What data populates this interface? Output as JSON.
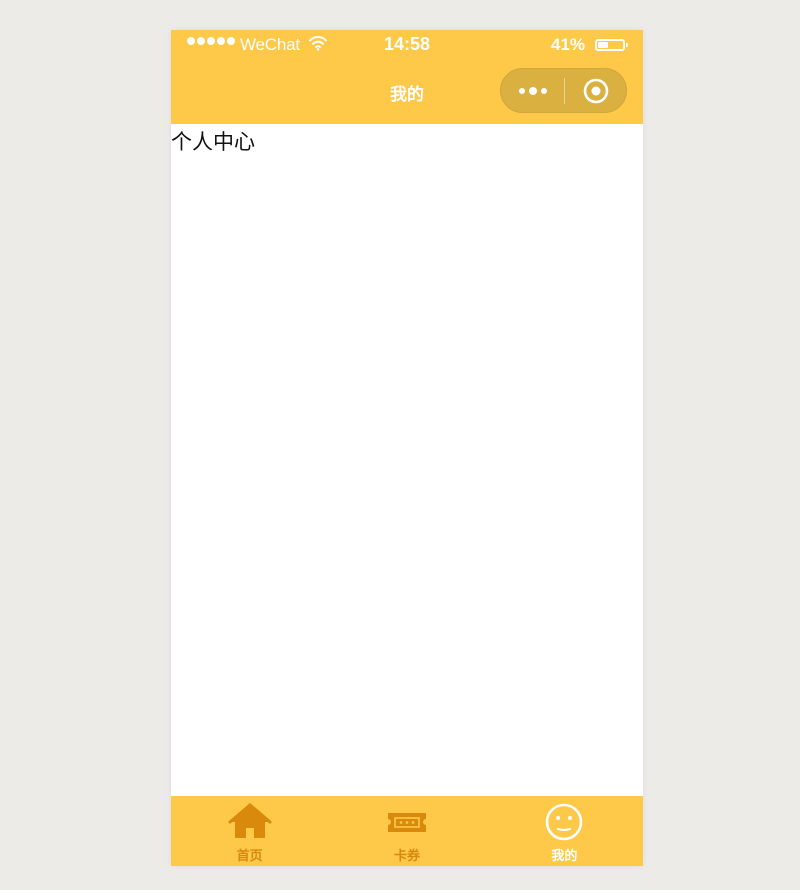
{
  "status_bar": {
    "carrier": "WeChat",
    "time": "14:58",
    "battery": "41%",
    "battery_level": 0.41,
    "signal_icon": "signal-dots-icon",
    "wifi_icon": "wifi-icon",
    "battery_icon": "battery-icon"
  },
  "nav": {
    "title": "我的",
    "more_icon": "more-dots-icon",
    "home_icon": "target-circle-icon"
  },
  "page": {
    "content_text": "个人中心"
  },
  "tabs": [
    {
      "label": "首页",
      "icon": "home-icon",
      "active": false
    },
    {
      "label": "卡券",
      "icon": "ticket-icon",
      "active": false
    },
    {
      "label": "我的",
      "icon": "smiley-face-icon",
      "active": true
    }
  ],
  "colors": {
    "theme": "#fec849",
    "background": "#ecebe8",
    "tab_inactive": "#d9890c",
    "tab_active": "#ffffff",
    "capsule": "#dab041"
  }
}
